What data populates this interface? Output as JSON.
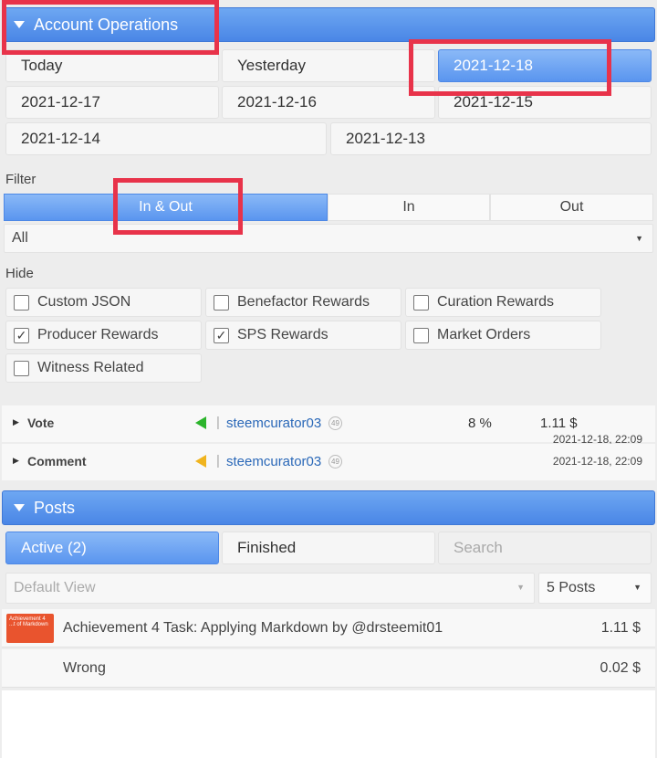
{
  "account_ops": {
    "title": "Account Operations",
    "dates": [
      "Today",
      "Yesterday",
      "2021-12-18",
      "2021-12-17",
      "2021-12-16",
      "2021-12-15",
      "2021-12-14",
      "2021-12-13"
    ],
    "selected_date": "2021-12-18"
  },
  "filter": {
    "label": "Filter",
    "tabs": [
      "In & Out",
      "In",
      "Out"
    ],
    "active_tab": "In & Out",
    "select_value": "All"
  },
  "hide": {
    "label": "Hide",
    "options": [
      {
        "label": "Custom JSON",
        "checked": false
      },
      {
        "label": "Benefactor Rewards",
        "checked": false
      },
      {
        "label": "Curation Rewards",
        "checked": false
      },
      {
        "label": "Producer Rewards",
        "checked": true
      },
      {
        "label": "SPS Rewards",
        "checked": true
      },
      {
        "label": "Market Orders",
        "checked": false
      },
      {
        "label": "Witness Related",
        "checked": false
      }
    ]
  },
  "operations": [
    {
      "type": "Vote",
      "direction_color": "#2bb42b",
      "user": "steemcurator03",
      "reputation": "49",
      "percent": "8 %",
      "amount": "1.11 $",
      "time": "2021-12-18, 22:09"
    },
    {
      "type": "Comment",
      "direction_color": "#f0b41e",
      "user": "steemcurator03",
      "reputation": "49",
      "time": "2021-12-18, 22:09"
    }
  ],
  "posts": {
    "title": "Posts",
    "tabs": [
      "Active (2)",
      "Finished"
    ],
    "search_placeholder": "Search",
    "view_select": "Default View",
    "count_select": "5 Posts",
    "items": [
      {
        "title": "Achievement 4 Task: Applying Markdown by @drsteemit01",
        "value": "1.11 $",
        "thumb_text": "Achievement 4 ...t of Markdown"
      },
      {
        "title": "Wrong",
        "value": "0.02 $"
      }
    ]
  },
  "colors": {
    "accent": "#4a86e6",
    "highlight": "#e8334a"
  }
}
